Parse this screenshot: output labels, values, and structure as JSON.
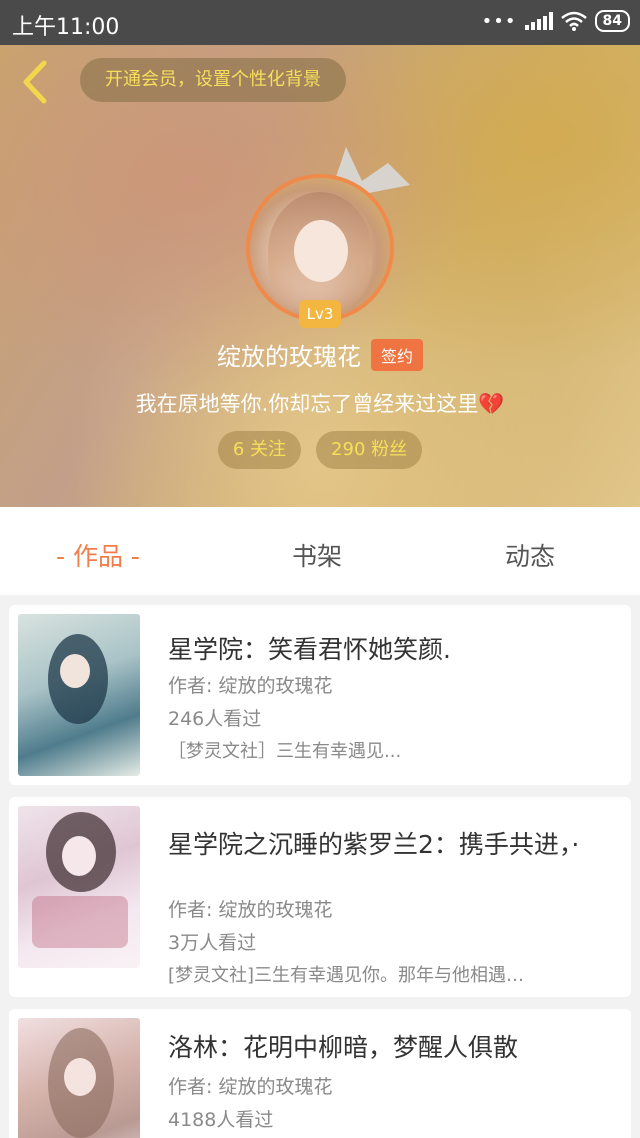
{
  "status_bar": {
    "time": "上午11:00",
    "battery": "84"
  },
  "header": {
    "vip_prompt": "开通会员，设置个性化背景",
    "level": "Lv3",
    "username": "绽放的玫瑰花",
    "sign_badge": "签约",
    "motto": "我在原地等你.你却忘了曾经来过这里",
    "motto_emoji": "💔",
    "following": "6 关注",
    "followers": "290 粉丝"
  },
  "tabs": {
    "works": "- 作品 -",
    "bookshelf": "书架",
    "activity": "动态"
  },
  "books": [
    {
      "title": "星学院：笑看君怀她笑颜.",
      "author": "作者: 绽放的玫瑰花",
      "views": "246人看过",
      "desc": "［梦灵文社］三生有幸遇见..."
    },
    {
      "title": "星学院之沉睡的紫罗兰2：携手共进，·",
      "author": "作者: 绽放的玫瑰花",
      "views": "3万人看过",
      "desc": "[梦灵文社]三生有幸遇见你。那年与他相遇…"
    },
    {
      "title": "洛林：花明中柳暗，梦醒人俱散",
      "author": "作者: 绽放的玫瑰花",
      "views": "4188人看过",
      "desc": ""
    }
  ],
  "colors": {
    "accent": "#f07d4a",
    "gold_text": "#f7df5a",
    "level_badge": "#f3b640"
  },
  "icons": {
    "back": "chevron-left-icon",
    "crown": "crown-icon",
    "wifi": "wifi-icon",
    "signal": "signal-icon"
  }
}
